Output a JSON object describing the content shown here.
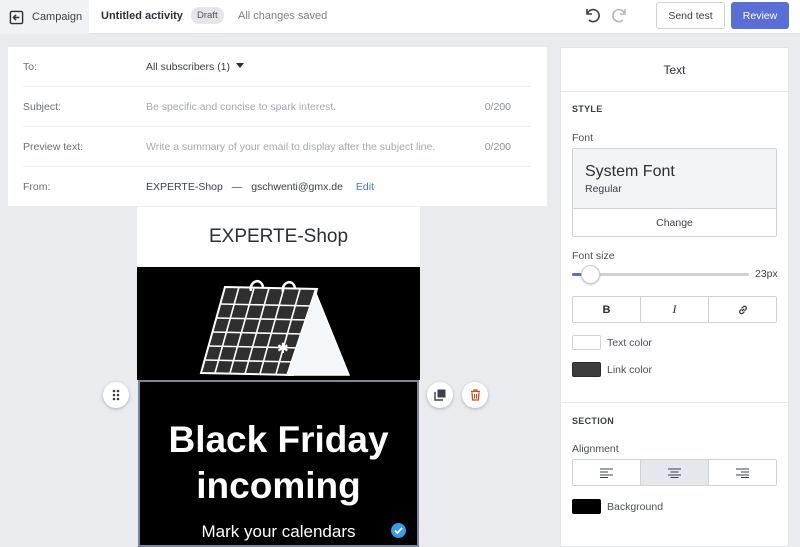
{
  "topbar": {
    "back_label": "Campaign",
    "title": "Untitled activity",
    "badge": "Draft",
    "status": "All changes saved",
    "send_test": "Send test",
    "review": "Review"
  },
  "fields": {
    "to": {
      "label": "To:",
      "value": "All subscribers (1)"
    },
    "subject": {
      "label": "Subject:",
      "placeholder": "Be specific and concise to spark interest.",
      "count": "0/200"
    },
    "preview": {
      "label": "Preview text:",
      "placeholder": "Write a summary of your email to display after the subject line.",
      "count": "0/200"
    },
    "from": {
      "label": "From:",
      "name": "EXPERTE-Shop",
      "separator": "—",
      "email": "gschwenti@gmx.de",
      "edit": "Edit"
    }
  },
  "email": {
    "header": "EXPERTE-Shop",
    "headline_1": "Black Friday",
    "headline_2": "incoming",
    "subline": "Mark your calendars"
  },
  "panel": {
    "title": "Text",
    "style_heading": "STYLE",
    "font_label": "Font",
    "font_name": "System Font",
    "font_weight": "Regular",
    "change": "Change",
    "font_size_label": "Font size",
    "font_size_value": "23px",
    "font_size_fraction": 0.1,
    "text_color_label": "Text color",
    "text_color": "#ffffff",
    "link_color_label": "Link color",
    "link_color": "#3d3d3d",
    "section_heading": "SECTION",
    "alignment_label": "Alignment",
    "alignment_selected": "center",
    "background_label": "Background",
    "background_color": "#000000"
  },
  "colors": {
    "accent": "#5a6fd6",
    "link": "#4a6fd1"
  }
}
